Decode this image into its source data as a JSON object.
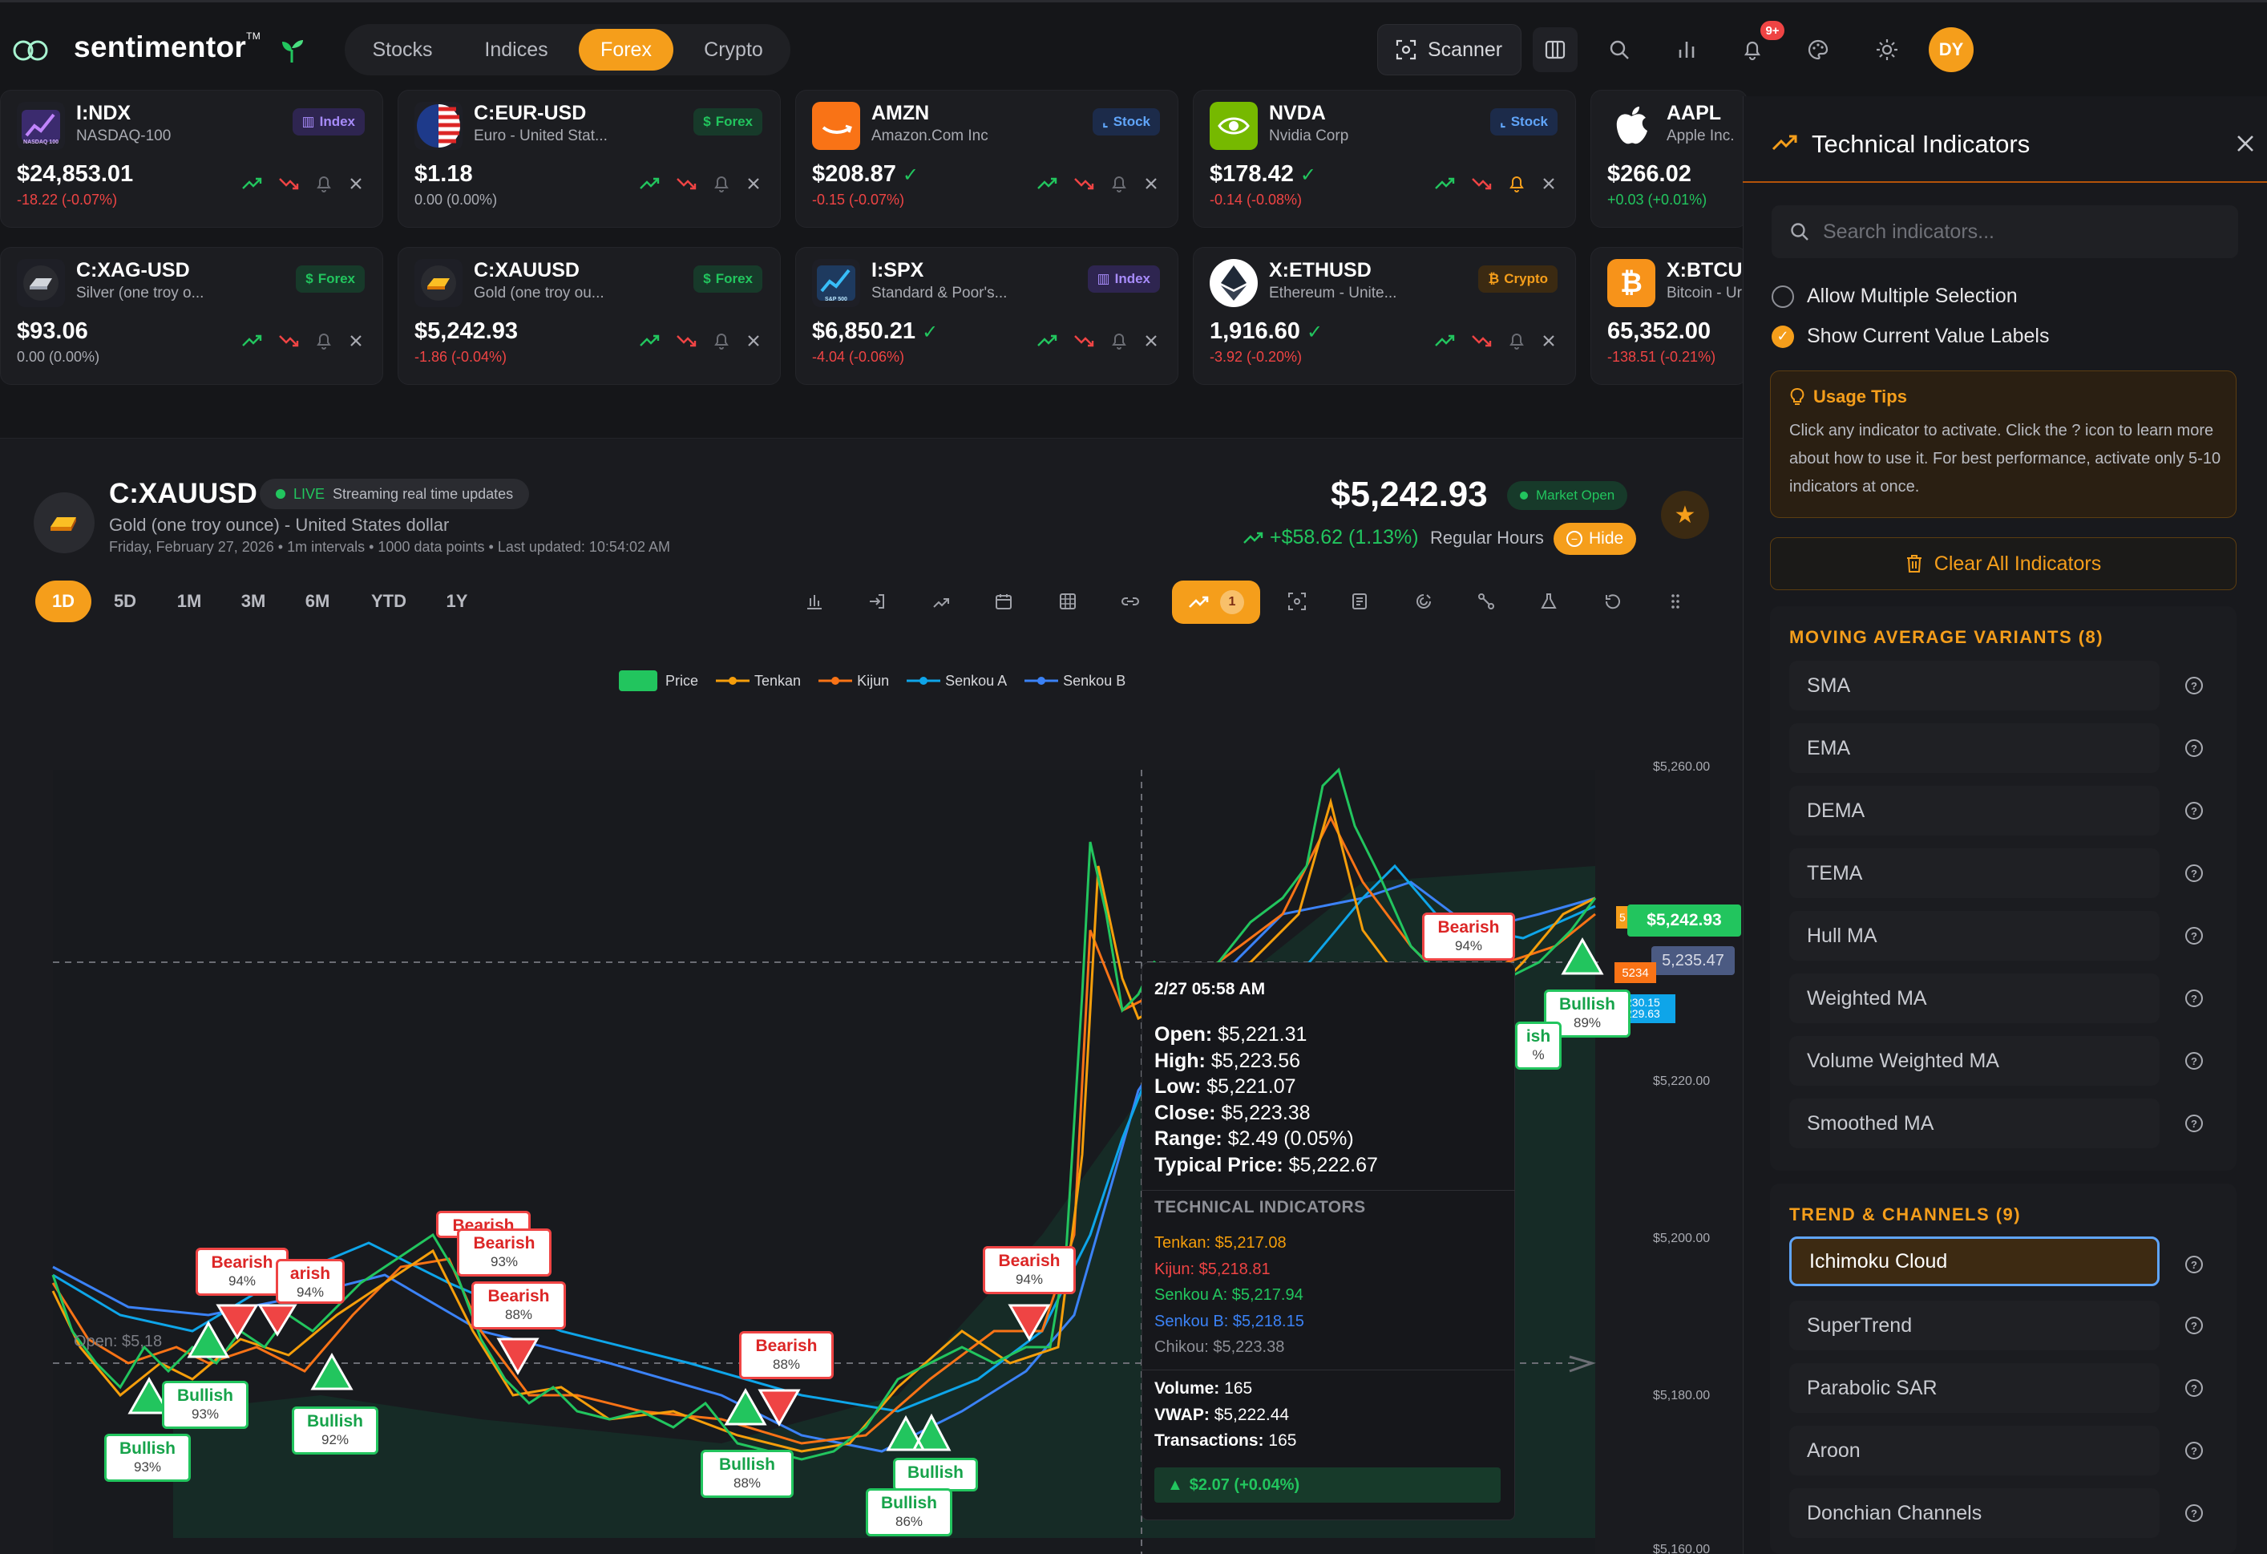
{
  "brand": {
    "name": "sentimentor",
    "tm": "TM"
  },
  "nav": {
    "tabs": [
      "Stocks",
      "Indices",
      "Forex",
      "Crypto"
    ],
    "active": "Forex"
  },
  "header": {
    "scanner_label": "Scanner",
    "notif_badge": "9+",
    "avatar_initials": "DY"
  },
  "tickers": [
    {
      "symbol": "I:NDX",
      "name": "NASDAQ-100",
      "badge": "Index",
      "price": "$24,853.01",
      "change": "-18.22 (-0.07%)"
    },
    {
      "symbol": "C:EUR-USD",
      "name": "Euro - United Stat...",
      "badge": "Forex",
      "price": "$1.18",
      "change": "0.00 (0.00%)"
    },
    {
      "symbol": "AMZN",
      "name": "Amazon.Com Inc",
      "badge": "Stock",
      "price": "$208.87",
      "change": "-0.15 (-0.07%)"
    },
    {
      "symbol": "NVDA",
      "name": "Nvidia Corp",
      "badge": "Stock",
      "price": "$178.42",
      "change": "-0.14 (-0.08%)"
    },
    {
      "symbol": "AAPL",
      "name": "Apple Inc.",
      "badge": "",
      "price": "$266.02",
      "change": "+0.03 (+0.01%)"
    },
    {
      "symbol": "C:XAG-USD",
      "name": "Silver (one troy o...",
      "badge": "Forex",
      "price": "$93.06",
      "change": "0.00 (0.00%)"
    },
    {
      "symbol": "C:XAUUSD",
      "name": "Gold (one troy ou...",
      "badge": "Forex",
      "price": "$5,242.93",
      "change": "-1.86 (-0.04%)"
    },
    {
      "symbol": "I:SPX",
      "name": "Standard & Poor's...",
      "badge": "Index",
      "price": "$6,850.21",
      "change": "-4.04 (-0.06%)"
    },
    {
      "symbol": "X:ETHUSD",
      "name": "Ethereum - Unite...",
      "badge": "Crypto",
      "price": "1,916.60",
      "change": "-3.92 (-0.20%)"
    },
    {
      "symbol": "X:BTCU",
      "name": "Bitcoin - Ur",
      "badge": "",
      "price": "65,352.00",
      "change": "-138.51 (-0.21%)"
    }
  ],
  "ticker_logos": {
    "ndx": "NASDAQ 100",
    "spx": "S&P 500"
  },
  "instrument": {
    "symbol": "C:XAUUSD",
    "live_label": "LIVE",
    "live_text": "Streaming real time updates",
    "name": "Gold (one troy ounce) - United States dollar",
    "meta": "Friday, February 27, 2026 • 1m intervals • 1000 data points • Last updated: 10:54:02 AM",
    "price": "$5,242.93",
    "market_status": "Market Open",
    "change": "+$58.62 (1.13%)",
    "session": "Regular Hours",
    "hide_label": "Hide"
  },
  "timeframes": [
    "1D",
    "5D",
    "1M",
    "3M",
    "6M",
    "YTD",
    "1Y"
  ],
  "active_timeframe": "1D",
  "indicator_count": "1",
  "legend": [
    "Price",
    "Tenkan",
    "Kijun",
    "Senkou A",
    "Senkou B"
  ],
  "colors": {
    "accent": "#f59e1b",
    "bull": "#22c55e",
    "bear": "#ef4444",
    "tenkan": "#f59e0b",
    "kijun": "#f97316",
    "senkou_a": "#0ea5e9",
    "senkou_b": "#3b82f6"
  },
  "chart_labels": {
    "open_line": "Open: $5,18",
    "y_ticks": [
      "$5,260.00",
      "$5,220.00",
      "$5,200.00",
      "$5,180.00",
      "$5,160.00"
    ],
    "current_price_tag": "$5,242.93",
    "line_tag": "5,235.47",
    "kijun_tag": "5234",
    "cut_tag_1": "5",
    "cut_tag_2": "230.15",
    "cut_tag_3": "229.63"
  },
  "signals": [
    {
      "type": "Bearish",
      "pct": "94%"
    },
    {
      "type": "Bearish",
      "pct": "94%"
    },
    {
      "type": "Bullish",
      "pct": "93%"
    },
    {
      "type": "Bullish",
      "pct": "93%"
    },
    {
      "type": "Bullish",
      "pct": "92%"
    },
    {
      "type": "Bearish",
      "pct": "93%"
    },
    {
      "type": "Bearish",
      "pct": "88%"
    },
    {
      "type": "Bearish",
      "pct": "88%"
    },
    {
      "type": "Bullish",
      "pct": "88%"
    },
    {
      "type": "Bullish",
      "pct": "86%"
    },
    {
      "type": "Bullish",
      "pct": ""
    },
    {
      "type": "Bearish",
      "pct": "94%"
    },
    {
      "type": "Bearish",
      "pct": "94%"
    },
    {
      "type": "Bullish",
      "pct": "89%"
    },
    {
      "type": "ish",
      "pct": "%"
    },
    {
      "type": "Bearish",
      "pct": ""
    },
    {
      "type": "arish",
      "pct": "94%"
    }
  ],
  "tooltip": {
    "time": "2/27 05:58 AM",
    "open": "$5,221.31",
    "high": "$5,223.56",
    "low": "$5,221.07",
    "close": "$5,223.38",
    "range": "$2.49 (0.05%)",
    "typical": "$5,222.67",
    "tech_header": "TECHNICAL INDICATORS",
    "tenkan": "Tenkan: $5,217.08",
    "kijun": "Kijun: $5,218.81",
    "senkou_a": "Senkou A: $5,217.94",
    "senkou_b": "Senkou B: $5,218.15",
    "chikou": "Chikou: $5,223.38",
    "volume": "165",
    "vwap": "$5,222.44",
    "transactions": "165",
    "change": "$2.07 (+0.04%)",
    "labels": {
      "open": "Open:",
      "high": "High:",
      "low": "Low:",
      "close": "Close:",
      "range": "Range:",
      "typical": "Typical Price:",
      "volume": "Volume:",
      "vwap": "VWAP:",
      "transactions": "Transactions:"
    }
  },
  "panel": {
    "title": "Technical Indicators",
    "search_placeholder": "Search indicators...",
    "allow_multiple": "Allow Multiple Selection",
    "show_labels": "Show Current Value Labels",
    "tips_title": "Usage Tips",
    "tips_text": "Click any indicator to activate. Click the ? icon to learn more about how to use it. For best performance, activate only 5-10 indicators at once.",
    "clear_label": "Clear All Indicators",
    "groups": [
      {
        "title": "MOVING AVERAGE VARIANTS (8)",
        "items": [
          "SMA",
          "EMA",
          "DEMA",
          "TEMA",
          "Hull MA",
          "Weighted MA",
          "Volume Weighted MA",
          "Smoothed MA"
        ]
      },
      {
        "title": "TREND & CHANNELS (9)",
        "items": [
          "Ichimoku Cloud",
          "SuperTrend",
          "Parabolic SAR",
          "Aroon",
          "Donchian Channels"
        ]
      }
    ],
    "active_item": "Ichimoku Cloud"
  }
}
